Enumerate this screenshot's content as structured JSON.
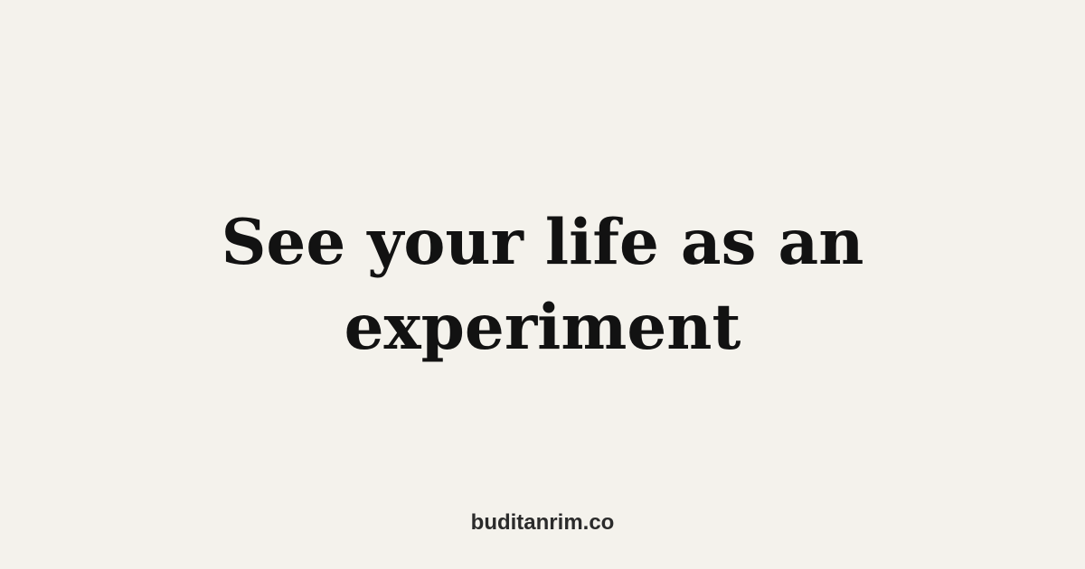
{
  "headline": {
    "line1": "See your life as an",
    "line2": "experiment"
  },
  "footer": {
    "site": "buditanrim.co"
  },
  "colors": {
    "background": "#f4f2ec",
    "headline": "#121212",
    "footer_text": "#2b2b2b"
  }
}
